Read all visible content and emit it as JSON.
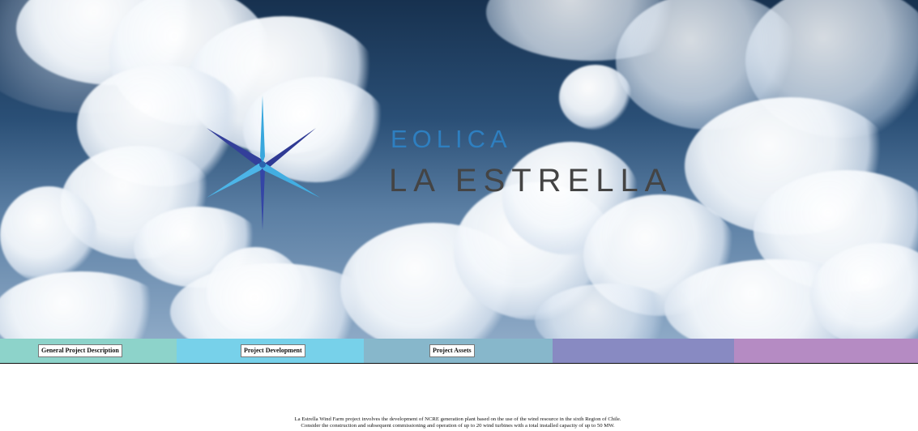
{
  "brand": {
    "subtitle": "EOLICA",
    "title": "LA ESTRELLA"
  },
  "navigation": {
    "items": [
      {
        "label": "General Project Description",
        "color": "#8dd3ca"
      },
      {
        "label": "Project Development",
        "color": "#77d1ea"
      },
      {
        "label": "Project Assets",
        "color": "#87b7cb"
      },
      {
        "label": "",
        "color": "#888ac2"
      },
      {
        "label": "",
        "color": "#b58bc3"
      }
    ]
  },
  "content": {
    "line1": "La Estrella Wind Farm project involves the development of NCRE generation plant based on the use of the wind resource in the sixth Region of Chile.",
    "line2": "Consider the construction and subsequent commissioning and operation of up to 20 wind turbines with a total installed capacity of up to 50 MW."
  },
  "icons": {
    "logo": "six-point-blue-star-icon"
  },
  "colors": {
    "sky": "#2a4f76",
    "brand_blue": "#2e7fc0",
    "brand_gray": "#444444"
  }
}
